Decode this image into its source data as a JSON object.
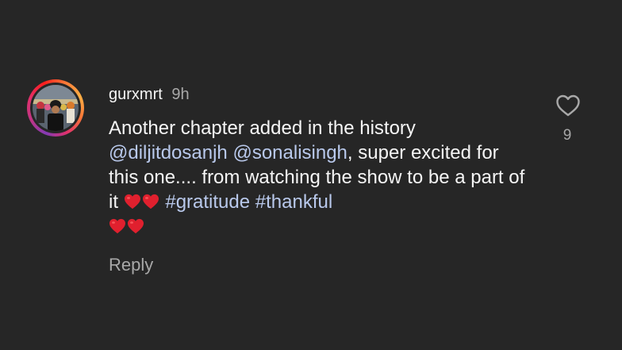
{
  "comment": {
    "username": "gurxmrt",
    "timestamp": "9h",
    "text_1": "Another chapter added in the history ",
    "mention_1": "@diljitdosanjh",
    "text_2": " ",
    "mention_2": "@sonalisingh",
    "text_3": ", super excited for this one.... from watching the show to be a part of it ",
    "text_4": " ",
    "hashtag_1": "#gratitude",
    "text_5": " ",
    "hashtag_2": "#thankful",
    "emojis": [
      "red-heart",
      "red-heart",
      "red-heart",
      "red-heart"
    ],
    "reply_label": "Reply",
    "like_count": "9"
  },
  "icons": {
    "like": "heart-outline-icon",
    "emoji": "red-heart-emoji"
  },
  "colors": {
    "background": "#262626",
    "text": "#f5f5f5",
    "secondary_text": "#a8a8a8",
    "link": "#b9c9ec",
    "heart_emoji": "#e0202e",
    "avatar_ring": [
      "#833ab4",
      "#e1306c",
      "#fcaf45"
    ]
  }
}
